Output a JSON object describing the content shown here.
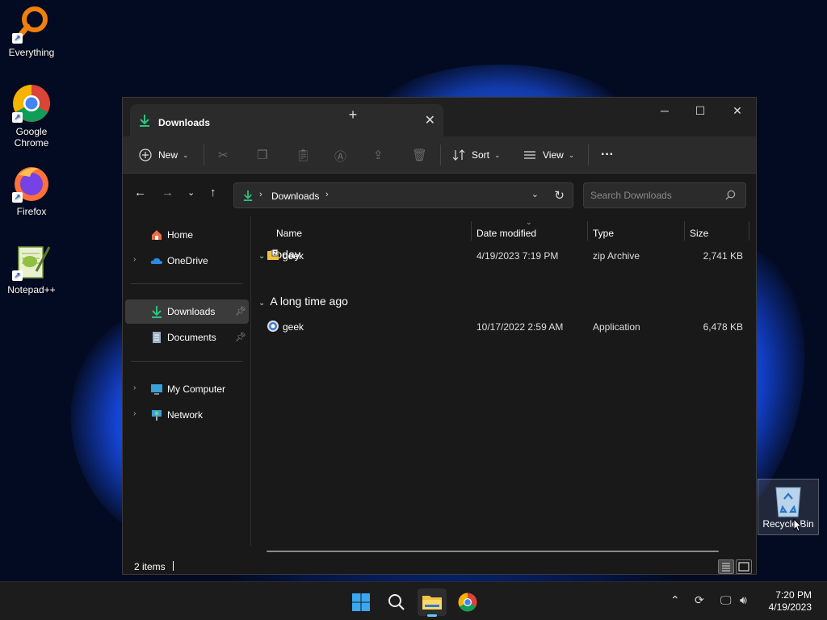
{
  "desktop": {
    "icons": [
      {
        "label": "Everything",
        "icon": "everything-icon"
      },
      {
        "label": "Google Chrome",
        "icon": "chrome-icon"
      },
      {
        "label": "Firefox",
        "icon": "firefox-icon"
      },
      {
        "label": "Notepad++",
        "icon": "notepadpp-icon"
      }
    ],
    "recycle_bin_label": "Recycle Bin"
  },
  "window": {
    "tab_title": "Downloads",
    "toolbar": {
      "new_label": "New",
      "sort_label": "Sort",
      "view_label": "View",
      "more_label": "···"
    },
    "address": {
      "crumb": "Downloads"
    },
    "search": {
      "placeholder": "Search Downloads"
    },
    "nav": {
      "items": [
        {
          "label": "Home"
        },
        {
          "label": "OneDrive"
        },
        {
          "label": "Downloads"
        },
        {
          "label": "Documents"
        },
        {
          "label": "My Computer"
        },
        {
          "label": "Network"
        }
      ]
    },
    "columns": {
      "name": "Name",
      "date": "Date modified",
      "type": "Type",
      "size": "Size"
    },
    "groups": [
      {
        "label": "Today",
        "files": [
          {
            "name": "geek",
            "date": "4/19/2023 7:19 PM",
            "type": "zip Archive",
            "size": "2,741 KB"
          }
        ]
      },
      {
        "label": "A long time ago",
        "files": [
          {
            "name": "geek",
            "date": "10/17/2022 2:59 AM",
            "type": "Application",
            "size": "6,478 KB"
          }
        ]
      }
    ],
    "status": {
      "count": "2 items"
    }
  },
  "taskbar": {
    "clock_time": "7:20 PM",
    "clock_date": "4/19/2023"
  },
  "colors": {
    "accent": "#60cdff",
    "window_bg": "#191919",
    "toolbar_bg": "#2b2b2b",
    "download_green": "#2ec27e"
  }
}
